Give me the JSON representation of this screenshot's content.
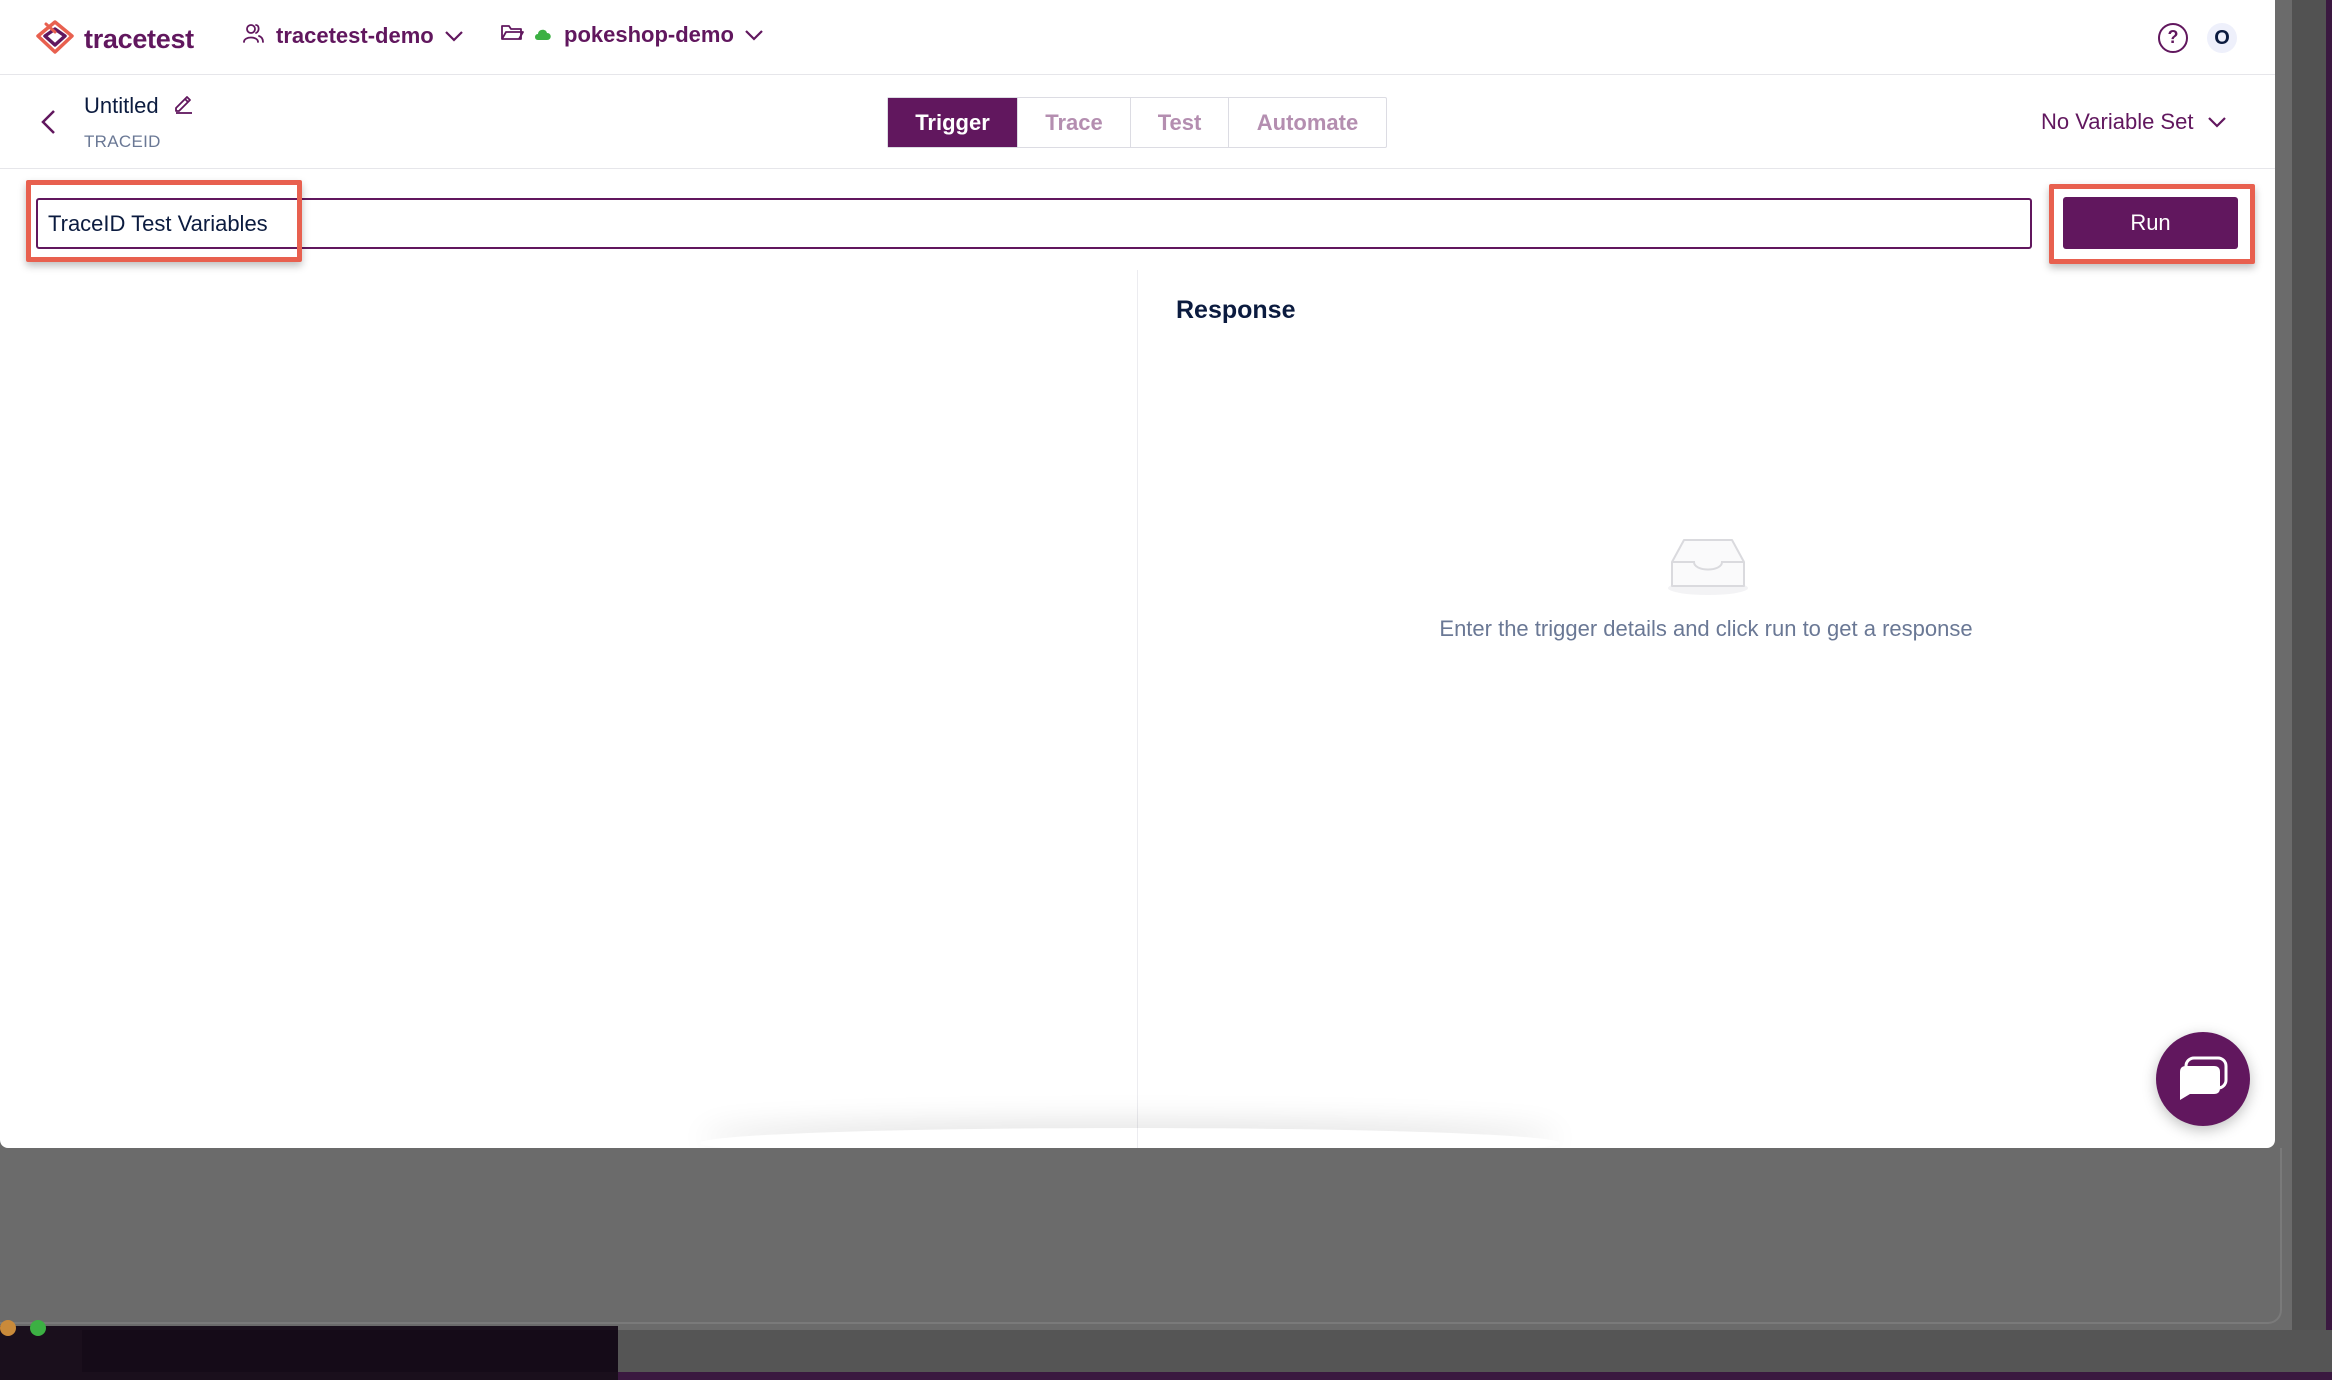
{
  "colors": {
    "brand": "#61175e",
    "text_primary": "#0b1b3f",
    "text_muted": "#6a7895",
    "highlight": "#e8604f",
    "status_online": "#3cb043"
  },
  "topbar": {
    "app_name": "tracetest",
    "organization": "tracetest-demo",
    "environment": "pokeshop-demo",
    "help_icon_label": "?",
    "avatar_initial": "O"
  },
  "test": {
    "title": "Untitled",
    "type": "TRACEID"
  },
  "tabs": [
    {
      "label": "Trigger",
      "active": true
    },
    {
      "label": "Trace",
      "active": false
    },
    {
      "label": "Test",
      "active": false
    },
    {
      "label": "Automate",
      "active": false
    }
  ],
  "variable_set": {
    "selected": "No Variable Set"
  },
  "trigger": {
    "input_value": "TraceID Test Variables",
    "run_label": "Run"
  },
  "response": {
    "title": "Response",
    "empty_message": "Enter the trigger details and click run to get a response"
  },
  "icons": {
    "logo": "tracetest-logo-icon",
    "organization": "user-group-icon",
    "environment": "folder-icon",
    "chevron": "chevron-down-icon",
    "back": "chevron-left-icon",
    "edit": "pencil-icon",
    "empty": "inbox-icon",
    "chat": "chat-bubble-icon"
  }
}
